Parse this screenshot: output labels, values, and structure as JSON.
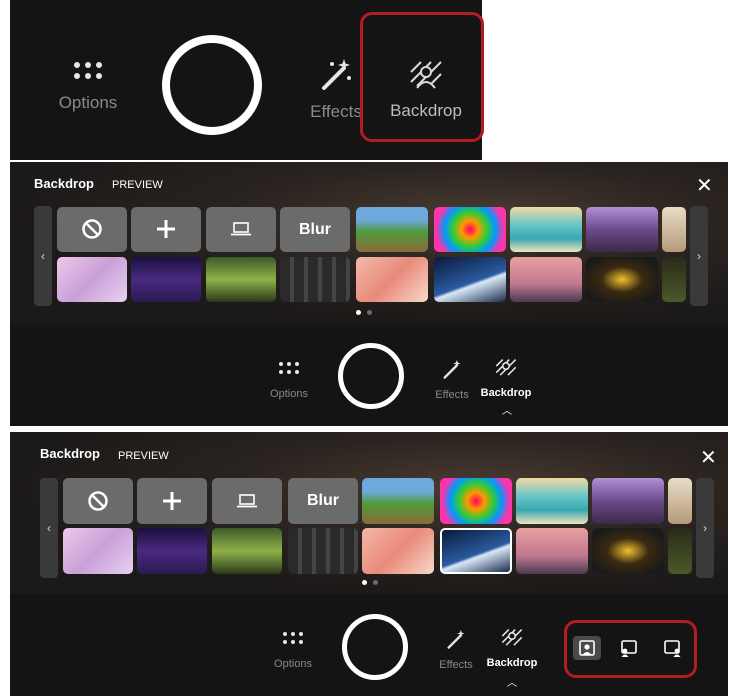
{
  "top_toolbar": {
    "options_label": "Options",
    "effects_label": "Effects",
    "backdrop_label": "Backdrop"
  },
  "panel1": {
    "title": "Backdrop",
    "subtitle": "PREVIEW",
    "close_glyph": "✕",
    "blur_label": "Blur",
    "toolbar": {
      "options_label": "Options",
      "effects_label": "Effects",
      "backdrop_label": "Backdrop"
    }
  },
  "panel2": {
    "title": "Backdrop",
    "subtitle": "PREVIEW",
    "close_glyph": "✕",
    "blur_label": "Blur",
    "toolbar": {
      "options_label": "Options",
      "effects_label": "Effects",
      "backdrop_label": "Backdrop"
    }
  },
  "colors": {
    "accent_red": "#b11d22",
    "tile_gray": "#6b6b6b",
    "bar": "#141414"
  },
  "icons": [
    "grid-dots-icon",
    "magic-wand-icon",
    "backdrop-icon",
    "no-background-icon",
    "plus-icon",
    "laptop-icon",
    "chevron-left-icon",
    "chevron-right-icon",
    "close-icon",
    "caret-up-icon",
    "person-center-icon",
    "person-left-icon",
    "person-right-icon"
  ]
}
